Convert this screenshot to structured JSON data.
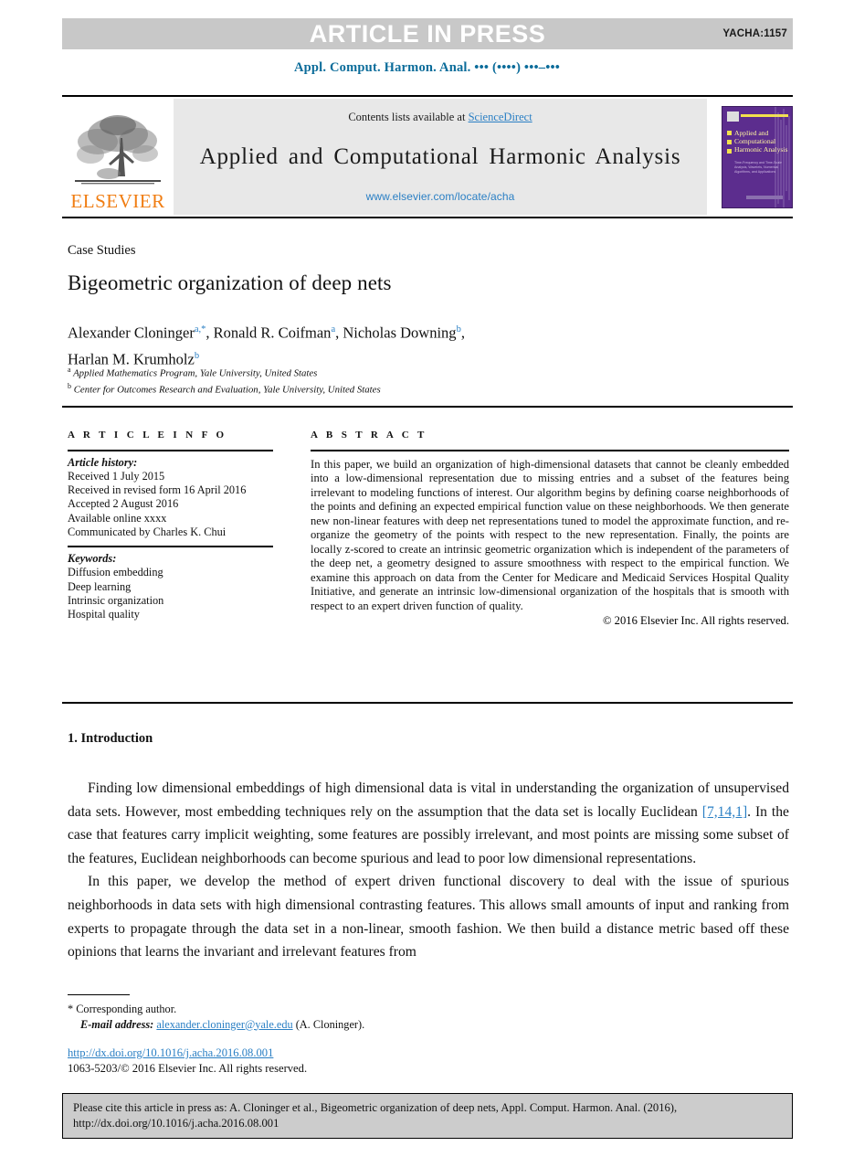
{
  "banner": {
    "text": "ARTICLE IN PRESS",
    "article_id": "YACHA:1157",
    "bg_color": "#c8c8c8"
  },
  "running_head": "Appl. Comput. Harmon. Anal. ••• (••••) •••–•••",
  "masthead": {
    "contents_prefix": "Contents lists available at ",
    "sciencedirect": "ScienceDirect",
    "journal_title": "Applied and Computational Harmonic Analysis",
    "journal_url": "www.elsevier.com/locate/acha",
    "publisher": "ELSEVIER",
    "cover": {
      "title": "Applied and Computational Harmonic Analysis",
      "subtitle": "Time-Frequency and Time-Scale Analysis, Wavelets, Numerical Algorithms, and Applications",
      "bg_color": "#5c2d8e",
      "accent_color": "#f2e14c"
    },
    "link_color": "#2a7fc4"
  },
  "article": {
    "section_label": "Case Studies",
    "title": "Bigeometric organization of deep nets",
    "authors": [
      {
        "name": "Alexander Cloninger",
        "marks": "a,*"
      },
      {
        "name": "Ronald R. Coifman",
        "marks": "a"
      },
      {
        "name": "Nicholas Downing",
        "marks": "b"
      },
      {
        "name": "Harlan M. Krumholz",
        "marks": "b"
      }
    ],
    "affiliations": [
      {
        "mark": "a",
        "text": "Applied Mathematics Program, Yale University, United States"
      },
      {
        "mark": "b",
        "text": "Center for Outcomes Research and Evaluation, Yale University, United States"
      }
    ]
  },
  "info": {
    "heading": "A R T I C L E    I N F O",
    "history_label": "Article history:",
    "history": [
      "Received 1 July 2015",
      "Received in revised form 16 April 2016",
      "Accepted 2 August 2016",
      "Available online xxxx",
      "Communicated by Charles K. Chui"
    ],
    "keywords_label": "Keywords:",
    "keywords": [
      "Diffusion embedding",
      "Deep learning",
      "Intrinsic organization",
      "Hospital quality"
    ]
  },
  "abstract": {
    "heading": "A B S T R A C T",
    "body": "In this paper, we build an organization of high-dimensional datasets that cannot be cleanly embedded into a low-dimensional representation due to missing entries and a subset of the features being irrelevant to modeling functions of interest. Our algorithm begins by defining coarse neighborhoods of the points and defining an expected empirical function value on these neighborhoods. We then generate new non-linear features with deep net representations tuned to model the approximate function, and re-organize the geometry of the points with respect to the new representation. Finally, the points are locally z-scored to create an intrinsic geometric organization which is independent of the parameters of the deep net, a geometry designed to assure smoothness with respect to the empirical function. We examine this approach on data from the Center for Medicare and Medicaid Services Hospital Quality Initiative, and generate an intrinsic low-dimensional organization of the hospitals that is smooth with respect to an expert driven function of quality.",
    "copyright": "© 2016 Elsevier Inc. All rights reserved."
  },
  "body": {
    "intro_heading": "1. Introduction",
    "para1_a": "Finding low dimensional embeddings of high dimensional data is vital in understanding the organization of unsupervised data sets. However, most embedding techniques rely on the assumption that the data set is locally Euclidean ",
    "para1_cite": "[7,14,1]",
    "para1_b": ". In the case that features carry implicit weighting, some features are possibly irrelevant, and most points are missing some subset of the features, Euclidean neighborhoods can become spurious and lead to poor low dimensional representations.",
    "para2": "In this paper, we develop the method of expert driven functional discovery to deal with the issue of spurious neighborhoods in data sets with high dimensional contrasting features. This allows small amounts of input and ranking from experts to propagate through the data set in a non-linear, smooth fashion. We then build a distance metric based off these opinions that learns the invariant and irrelevant features from"
  },
  "footnotes": {
    "corresponding": "* Corresponding author.",
    "email_label": "E-mail address:",
    "email": "alexander.cloninger@yale.edu",
    "email_attribution": "(A. Cloninger)."
  },
  "doi": {
    "url": "http://dx.doi.org/10.1016/j.acha.2016.08.001",
    "issn_line": "1063-5203/© 2016 Elsevier Inc. All rights reserved."
  },
  "cite_box": {
    "text": "Please cite this article in press as: A. Cloninger et al., Bigeometric organization of deep nets, Appl. Comput. Harmon. Anal. (2016), http://dx.doi.org/10.1016/j.acha.2016.08.001"
  }
}
